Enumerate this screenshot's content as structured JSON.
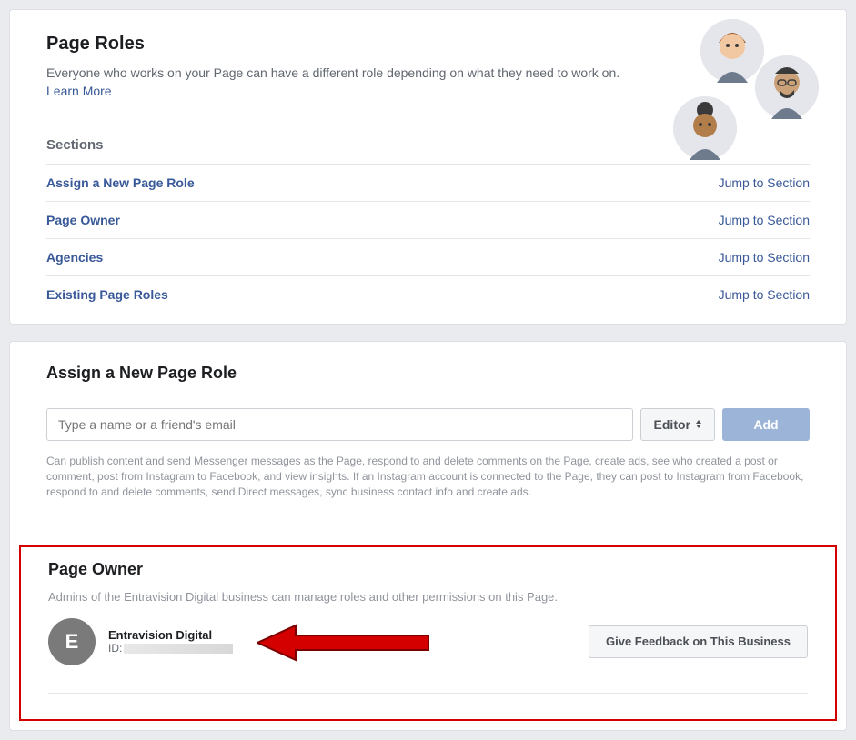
{
  "header": {
    "title": "Page Roles",
    "intro_text": "Everyone who works on your Page can have a different role depending on what they need to work on. ",
    "learn_more": "Learn More"
  },
  "sections": {
    "label": "Sections",
    "jump_label": "Jump to Section",
    "items": [
      "Assign a New Page Role",
      "Page Owner",
      "Agencies",
      "Existing Page Roles"
    ]
  },
  "assign": {
    "title": "Assign a New Page Role",
    "placeholder": "Type a name or a friend's email",
    "role_label": "Editor",
    "add_label": "Add",
    "description": "Can publish content and send Messenger messages as the Page, respond to and delete comments on the Page, create ads, see who created a post or comment, post from Instagram to Facebook, and view insights. If an Instagram account is connected to the Page, they can post to Instagram from Facebook, respond to and delete comments, send Direct messages, sync business contact info and create ads."
  },
  "owner": {
    "title": "Page Owner",
    "description": "Admins of the Entravision Digital business can manage roles and other permissions on this Page.",
    "avatar_letter": "E",
    "name": "Entravision Digital",
    "id_label": "ID:",
    "feedback_label": "Give Feedback on This Business"
  }
}
